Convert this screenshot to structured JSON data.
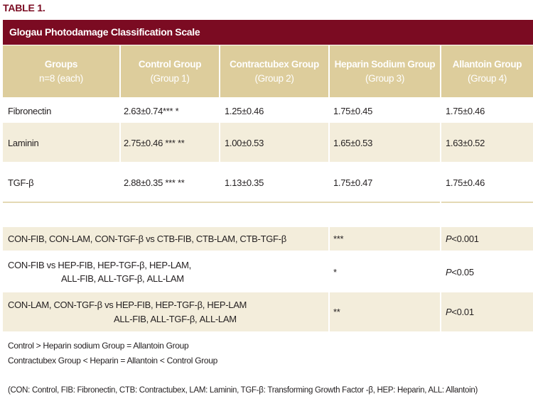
{
  "table_label": "TABLE 1.",
  "title": "Glogau Photodamage Classification Scale",
  "headers": [
    {
      "line1": "Groups",
      "line2": "n=8 (each)"
    },
    {
      "line1": "Control  Group",
      "line2": "(Group 1)"
    },
    {
      "line1": "Contractubex Group",
      "line2": "(Group 2)"
    },
    {
      "line1": "Heparin Sodium Group",
      "line2": "(Group 3)"
    },
    {
      "line1": "Allantoin Group",
      "line2": "(Group 4)"
    }
  ],
  "rows": [
    {
      "label": "Fibronectin",
      "g1": "2.63±0.74***  *",
      "g2": "1.25±0.46",
      "g3": "1.75±0.45",
      "g4": "1.75±0.46"
    },
    {
      "label": "Laminin",
      "g1": "2.75±0.46 ***  **",
      "g2": "1.00±0.53",
      "g3": "1.65±0.53",
      "g4": "1.63±0.52"
    },
    {
      "label": "TGF-β",
      "g1": "2.88±0.35 ***  **",
      "g2": "1.13±0.35",
      "g3": "1.75±0.47",
      "g4": "1.75±0.46"
    }
  ],
  "comparisons": [
    {
      "line1": "CON-FIB, CON-LAM, CON-TGF-β vs CTB-FIB, CTB-LAM, CTB-TGF-β",
      "line2": "",
      "mark": "***",
      "p_label": "P",
      "p_value": "<0.001"
    },
    {
      "line1": "CON-FIB vs HEP-FIB, HEP-TGF-β, HEP-LAM,",
      "line2": "ALL-FIB, ALL-TGF-β, ALL-LAM",
      "mark": "*",
      "p_label": "P",
      "p_value": "<0.05"
    },
    {
      "line1": "CON-LAM, CON-TGF-β vs HEP-FIB, HEP-TGF-β, HEP-LAM",
      "line2": "ALL-FIB, ALL-TGF-β, ALL-LAM",
      "mark": "**",
      "p_label": "P",
      "p_value": "<0.01"
    }
  ],
  "notes": [
    "Control > Heparin sodium Group = Allantoin Group",
    "Contractubex Group < Heparin = Allantoin < Control Group"
  ],
  "abbreviations": "(CON: Control, FIB: Fibronectin, CTB: Contractubex, LAM: Laminin, TGF-β: Transforming Growth Factor -β, HEP: Heparin, ALL: Allantoin)",
  "colors": {
    "title_bg": "#7b0b22",
    "header_bg": "#ddcd9c",
    "row_shade": "#f3eddb"
  }
}
